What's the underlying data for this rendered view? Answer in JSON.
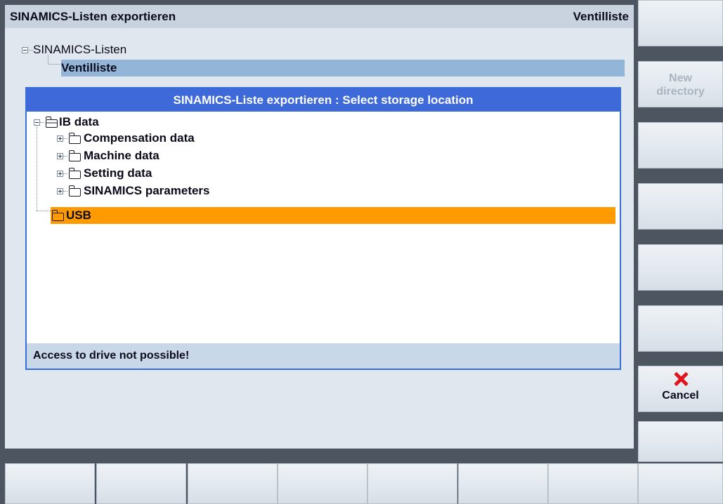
{
  "header": {
    "title": "SINAMICS-Listen exportieren",
    "context": "Ventilliste"
  },
  "outer_tree": {
    "root_label": "SINAMICS-Listen",
    "selected_child": "Ventilliste"
  },
  "dialog": {
    "title": "SINAMICS-Liste exportieren : Select storage location",
    "status": "Access to drive not possible!",
    "tree": {
      "root": "IB data",
      "children": [
        "Compensation data",
        "Machine data",
        "Setting data",
        "SINAMICS parameters"
      ],
      "selected": "USB"
    }
  },
  "softkeys_vertical": [
    {
      "label": ""
    },
    {
      "label_line1": "New",
      "label_line2": "directory",
      "enabled": false
    },
    {
      "label": ""
    },
    {
      "label": ""
    },
    {
      "label": ""
    },
    {
      "label": ""
    },
    {
      "label": "Cancel",
      "icon": "cancel-x-icon"
    },
    {
      "label": ""
    }
  ],
  "softkeys_horizontal_count": 8,
  "colors": {
    "dialog_title_bg": "#3d6ad8",
    "selection_orange": "#ff9a00",
    "outer_selection_blue": "#92b5d8",
    "cancel_red": "#e0141a"
  }
}
